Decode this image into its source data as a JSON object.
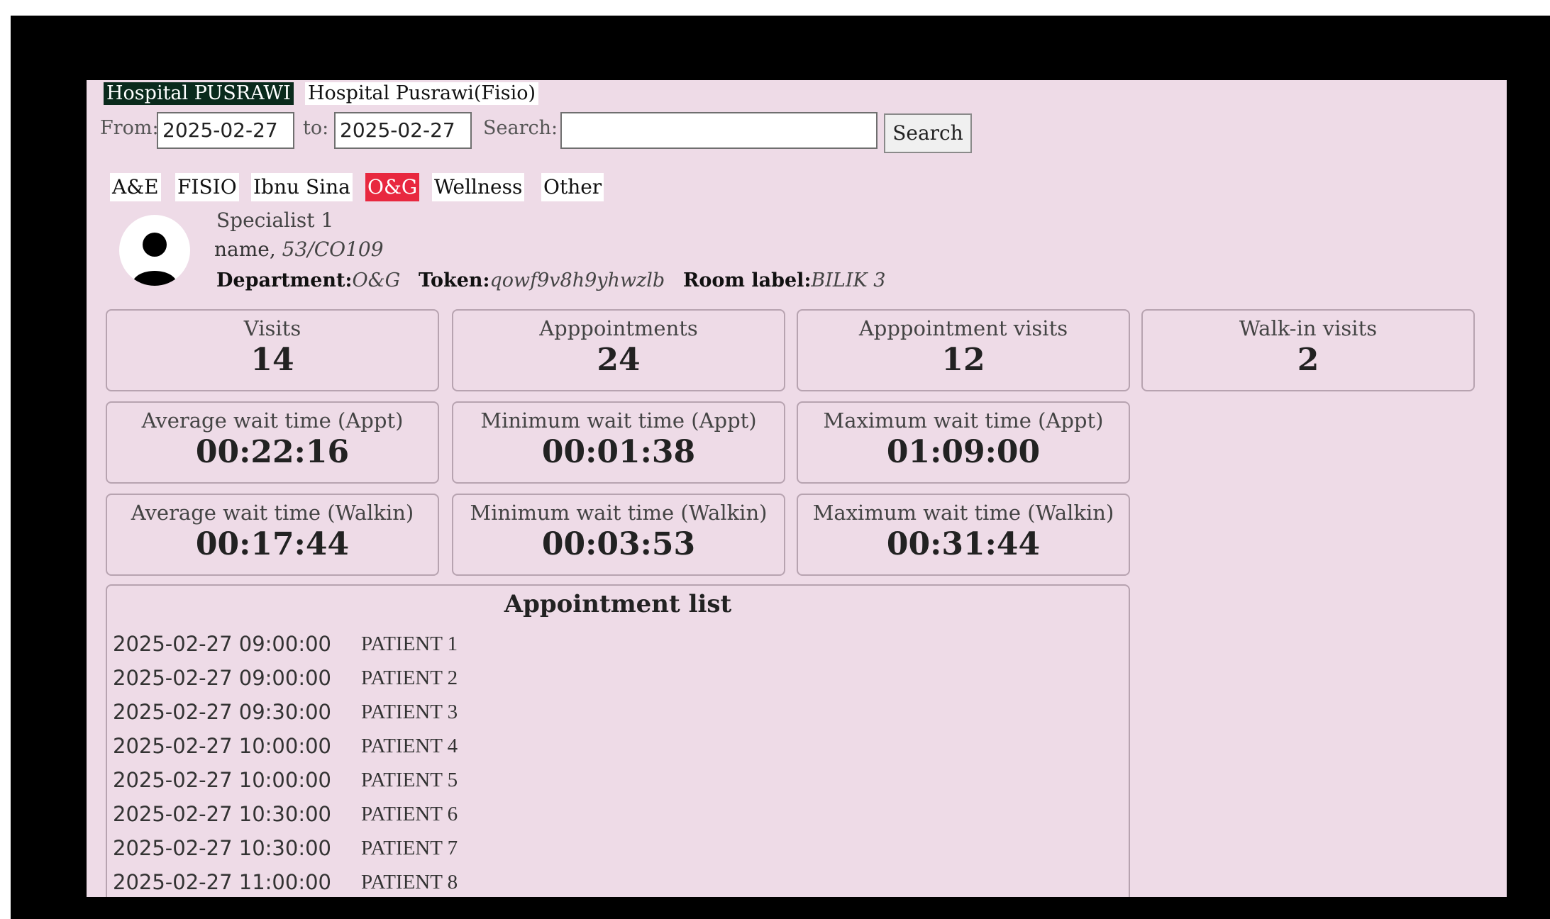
{
  "hospital_tabs": [
    "Hospital PUSRAWI",
    "Hospital Pusrawi(Fisio)"
  ],
  "filter": {
    "from_label": "From:",
    "from_value": "2025-02-27",
    "to_label": "to:",
    "to_value": "2025-02-27",
    "search_label": "Search:",
    "search_value": "",
    "search_button": "Search"
  },
  "department_tabs": [
    "A&E",
    "FISIO",
    "Ibnu Sina",
    "O&G",
    "Wellness",
    "Other"
  ],
  "active_department": "O&G",
  "doctor": {
    "title": "Specialist 1",
    "name": "name,",
    "code": "53/CO109",
    "department_label": "Department:",
    "department": "O&G",
    "token_label": "Token:",
    "token": "qowf9v8h9yhwzlb",
    "room_label": "Room label:",
    "room": "BILIK 3",
    "avatar_icon": "user-icon"
  },
  "stats": {
    "visits": {
      "label": "Visits",
      "value": "14"
    },
    "appointments": {
      "label": "Apppointments",
      "value": "24"
    },
    "appointment_visits": {
      "label": "Apppointment visits",
      "value": "12"
    },
    "walkin_visits": {
      "label": "Walk-in visits",
      "value": "2"
    },
    "avg_wait_appt": {
      "label": "Average wait time (Appt)",
      "value": "00:22:16"
    },
    "min_wait_appt": {
      "label": "Minimum wait time (Appt)",
      "value": "00:01:38"
    },
    "max_wait_appt": {
      "label": "Maximum wait time (Appt)",
      "value": "01:09:00"
    },
    "avg_wait_walkin": {
      "label": "Average wait time (Walkin)",
      "value": "00:17:44"
    },
    "min_wait_walkin": {
      "label": "Minimum wait time (Walkin)",
      "value": "00:03:53"
    },
    "max_wait_walkin": {
      "label": "Maximum wait time (Walkin)",
      "value": "00:31:44"
    }
  },
  "appointment_list": {
    "title": "Appointment list",
    "rows": [
      {
        "time": "2025-02-27 09:00:00",
        "patient": "PATIENT 1"
      },
      {
        "time": "2025-02-27 09:00:00",
        "patient": "PATIENT 2"
      },
      {
        "time": "2025-02-27 09:30:00",
        "patient": "PATIENT 3"
      },
      {
        "time": "2025-02-27 10:00:00",
        "patient": "PATIENT 4"
      },
      {
        "time": "2025-02-27 10:00:00",
        "patient": "PATIENT 5"
      },
      {
        "time": "2025-02-27 10:30:00",
        "patient": "PATIENT 6"
      },
      {
        "time": "2025-02-27 10:30:00",
        "patient": "PATIENT 7"
      },
      {
        "time": "2025-02-27 11:00:00",
        "patient": "PATIENT 8"
      }
    ]
  },
  "colors": {
    "background": "#eedbe7",
    "active_hospital_tab": "#0a2a1c",
    "active_department_tab": "#e8283f",
    "frame": "#000000"
  }
}
